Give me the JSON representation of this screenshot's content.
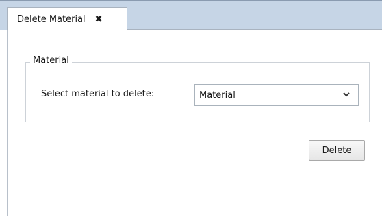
{
  "tab": {
    "title": "Delete Material",
    "close_glyph": "✖"
  },
  "group": {
    "legend": "Material"
  },
  "form": {
    "field_label": "Select material to delete:",
    "selected_value": "Material",
    "dropdown_icon": "chevron-down-icon"
  },
  "actions": {
    "delete_label": "Delete"
  }
}
